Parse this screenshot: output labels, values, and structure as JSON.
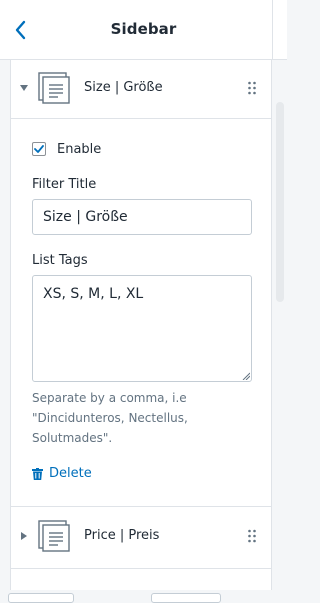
{
  "header": {
    "title": "Sidebar"
  },
  "items": [
    {
      "label": "Size | Größe",
      "expanded": true
    },
    {
      "label": "Price | Preis",
      "expanded": false
    }
  ],
  "form": {
    "enable_label": "Enable",
    "enable_checked": true,
    "filter_title_label": "Filter Title",
    "filter_title_value": "Size | Größe",
    "list_tags_label": "List Tags",
    "list_tags_value": "XS, S, M, L, XL",
    "help_text": "Separate by a comma, i.e \"Dincidunteros, Nectellus, Solutmades\".",
    "delete_label": "Delete"
  },
  "colors": {
    "accent": "#006fbb",
    "text": "#212b36",
    "muted": "#637381",
    "border": "#dfe3e8",
    "background": "#f4f6f8"
  },
  "icons": {
    "back": "chevron-left-icon",
    "collapse": "caret-down-icon",
    "expand": "caret-right-icon",
    "drag": "drag-handle-icon",
    "section": "text-block-icon",
    "delete": "trash-icon",
    "checkbox": "checkmark-icon"
  }
}
